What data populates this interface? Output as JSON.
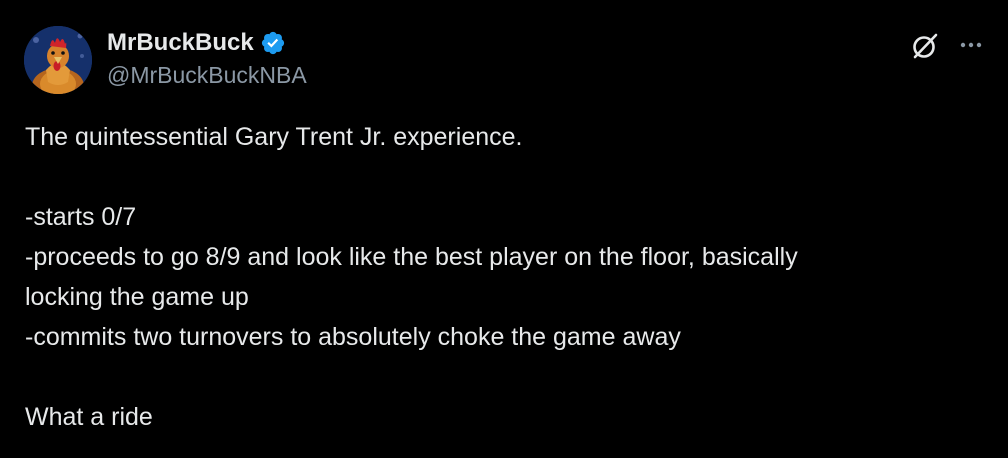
{
  "author": {
    "display_name": "MrBuckBuck",
    "handle": "@MrBuckBuckNBA",
    "verified": true,
    "verified_color": "#1d9bf0",
    "avatar_icon": "rooster-avatar"
  },
  "actions": {
    "grok_icon": "grok-icon",
    "more_icon": "more-icon"
  },
  "tweet": {
    "lines": [
      "The quintessential Gary Trent Jr. experience.",
      "",
      "-starts 0/7",
      "-proceeds to go 8/9 and look like the best player on the floor, basically",
      "locking the game up",
      "-commits two turnovers to absolutely choke the game away",
      "",
      "What a ride"
    ]
  },
  "colors": {
    "background": "#000000",
    "text_primary": "#e7e9ea",
    "text_secondary": "#8b98a5"
  }
}
